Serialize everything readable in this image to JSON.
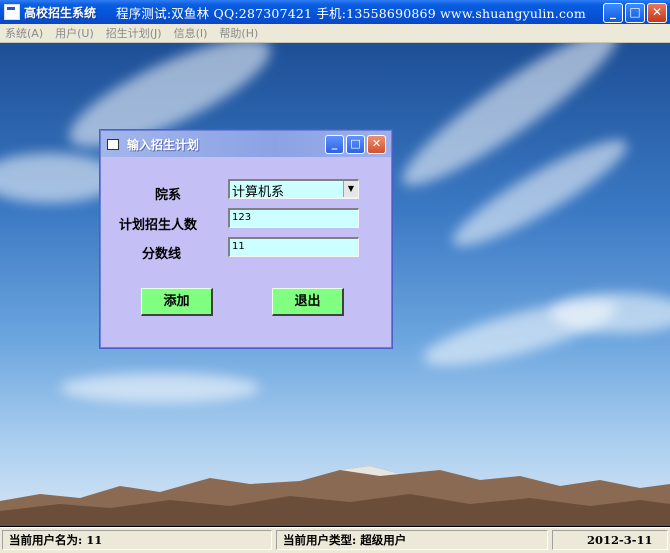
{
  "window": {
    "title": "高校招生系统",
    "banner": "程序测试:双鱼林 QQ:287307421 手机:13558690869 www.shuangyulin.com",
    "controls": {
      "minimize": "_",
      "maximize": "□",
      "close": "✕"
    }
  },
  "menu": [
    {
      "label": "系统(A)"
    },
    {
      "label": "用户(U)"
    },
    {
      "label": "招生计划(J)"
    },
    {
      "label": "信息(I)"
    },
    {
      "label": "帮助(H)"
    }
  ],
  "dialog": {
    "title": "输入招生计划",
    "controls": {
      "minimize": "_",
      "maximize": "□",
      "close": "✕"
    },
    "department_label": "院系",
    "department_value": "计算机系",
    "dropdown_arrow": "▼",
    "plan_count_label": "计划招生人数",
    "plan_count_value": "123",
    "score_label": "分数线",
    "score_value": "11",
    "add_button": "添加",
    "exit_button": "退出"
  },
  "status": {
    "user_name": "当前用户名为: 11",
    "user_type": "当前用户类型: 超级用户",
    "date": "2012-3-11"
  },
  "colors": {
    "titlebar": "#0553d8",
    "dialog_bg": "#c4c0f6",
    "field_bg": "#ccffff",
    "button_bg": "#80ff80"
  },
  "icons": [
    "app-icon",
    "dialog-icon",
    "dropdown-arrow-icon"
  ]
}
